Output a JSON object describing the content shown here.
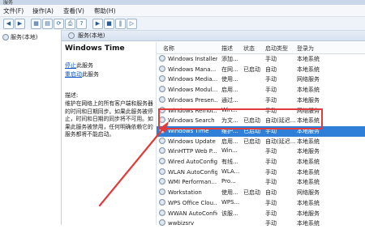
{
  "window": {
    "title": "服务"
  },
  "menu": [
    "文件(F)",
    "操作(A)",
    "查看(V)",
    "帮助(H)"
  ],
  "toolbar": {
    "buttons": [
      "◀",
      "▶",
      "▦",
      "▤",
      "⟳",
      "⎙",
      "?",
      "▶",
      "■",
      "‖",
      "▷"
    ]
  },
  "left_pane": {
    "item": "服务(本地)"
  },
  "header": {
    "title": "服务(本地)"
  },
  "description": {
    "service_title": "Windows Time",
    "stop_link": "停止",
    "stop_suffix": "此服务",
    "restart_link": "重启动",
    "restart_suffix": "此服务",
    "desc_label": "描述:",
    "desc_text": "维护在网络上的所有客户端和服务器的时间和日期同步。如果此服务被停止，时间和日期的同步将不可用。如果此服务被禁用，任何明确依赖它的服务都将不能启动。"
  },
  "table": {
    "headers": [
      "名称",
      "描述",
      "状态",
      "启动类型",
      "登录为"
    ],
    "rows": [
      [
        "Windows Installer",
        "添加...",
        "",
        "手动",
        "本地系统"
      ],
      [
        "Windows Mana...",
        "在网...",
        "已启动",
        "自动",
        "本地系统"
      ],
      [
        "Windows Media...",
        "使用...",
        "",
        "手动",
        "网络服务"
      ],
      [
        "Windows Modul...",
        "启用...",
        "",
        "手动",
        "本地系统"
      ],
      [
        "Windows Presen...",
        "通过...",
        "",
        "手动",
        "本地服务"
      ],
      [
        "Windows Remot...",
        "Win...",
        "",
        "手动",
        "网络服务"
      ],
      [
        "Windows Search",
        "为文...",
        "已启动",
        "自动(延迟...",
        "本地系统"
      ],
      [
        "Windows Time",
        "维护...",
        "已启动",
        "手动",
        "本地服务"
      ],
      [
        "Windows Update",
        "启用...",
        "已启动",
        "自动(延迟...",
        "本地系统"
      ],
      [
        "WinHTTP Web P...",
        "Win...",
        "",
        "手动",
        "本地服务"
      ],
      [
        "Wired AutoConfig",
        "有线...",
        "",
        "手动",
        "本地系统"
      ],
      [
        "WLAN AutoConfig",
        "WLA...",
        "",
        "手动",
        "本地系统"
      ],
      [
        "WMI Performan...",
        "Pro...",
        "",
        "手动",
        "本地系统"
      ],
      [
        "Workstation",
        "使用...",
        "已启动",
        "自动",
        "网络服务"
      ],
      [
        "WPS Office Clou...",
        "WPS...",
        "",
        "手动",
        "本地系统"
      ],
      [
        "WWAN AutoConfig",
        "该服...",
        "",
        "手动",
        "本地服务"
      ],
      [
        "wwbizsrv",
        "",
        "",
        "手动",
        "本地系统"
      ]
    ],
    "selected_row": 7
  },
  "colors": {
    "selection": "#2f7fd8",
    "annotation": "#e23b3b"
  }
}
